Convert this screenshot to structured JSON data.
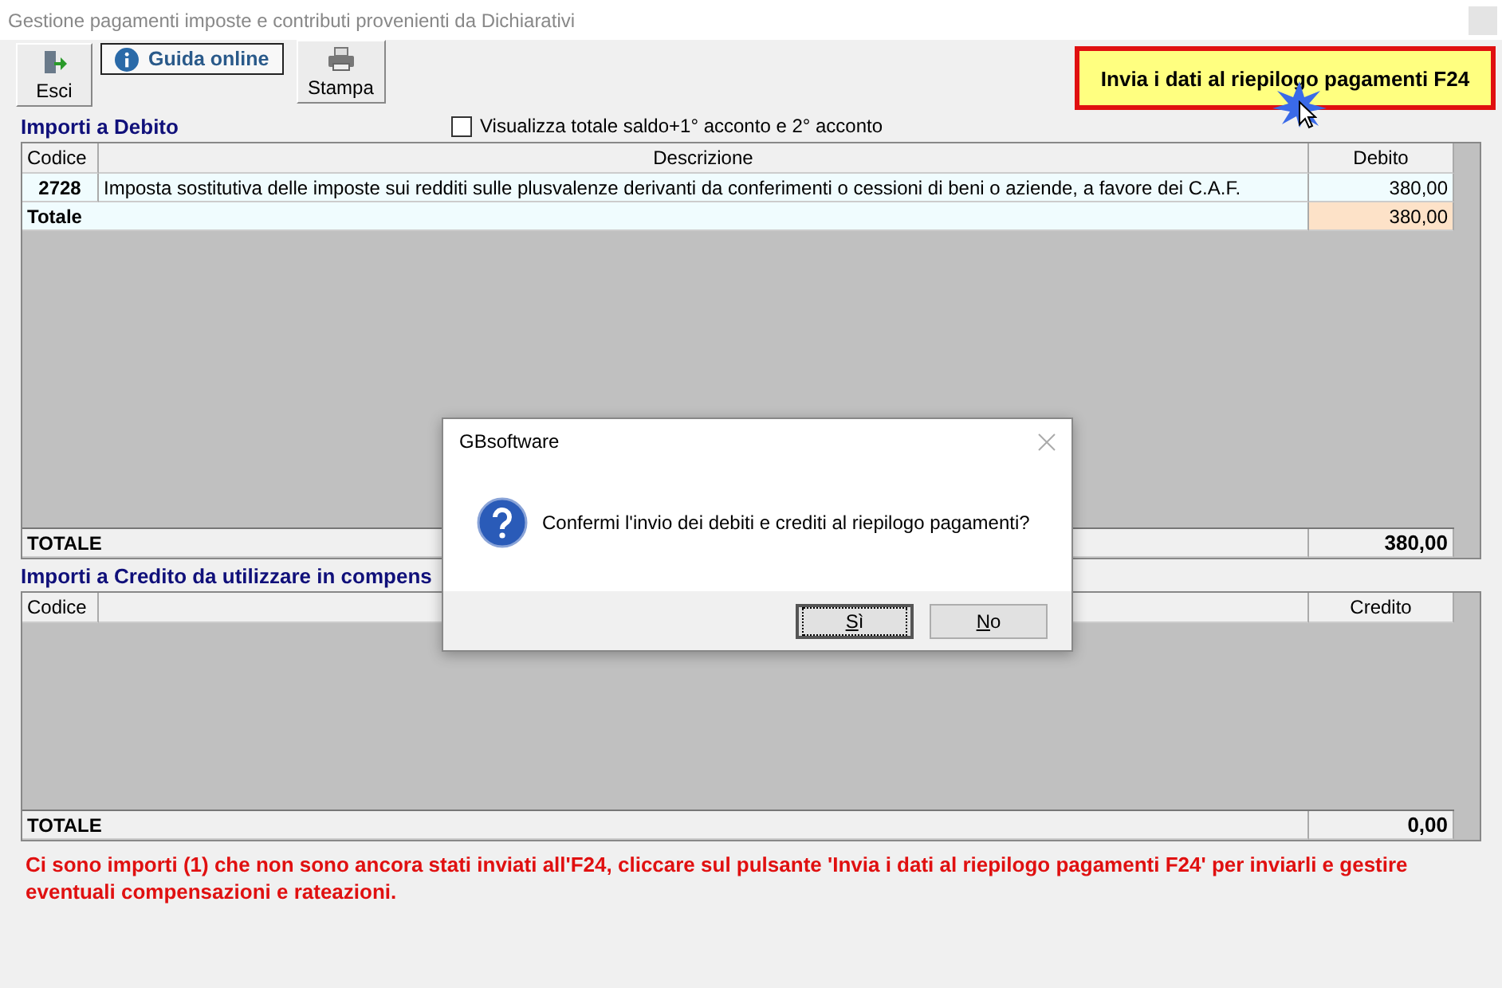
{
  "window": {
    "title": "Gestione pagamenti imposte e contributi provenienti da Dichiarativi"
  },
  "toolbar": [
    {
      "label": "Esci",
      "kind": "exit"
    },
    {
      "label": "Guida online",
      "kind": "help"
    },
    {
      "label": "Stampa",
      "kind": "print"
    }
  ],
  "send_button": {
    "label": "Invia i dati al riepilogo pagamenti F24"
  },
  "debit": {
    "title": "Importi a Debito",
    "checkbox": {
      "label": "Visualizza totale saldo+1° acconto e 2° acconto",
      "checked": false
    },
    "columns": [
      "Codice",
      "Descrizione",
      "Debito"
    ],
    "rows": [
      {
        "code": "2728",
        "description": "Imposta sostitutiva delle imposte sui redditi sulle plusvalenze derivanti da conferimenti o cessioni di beni o aziende, a favore dei C.A.F.",
        "amount": "380,00"
      }
    ],
    "subtotal": {
      "label": "Totale",
      "amount": "380,00"
    },
    "total": {
      "label": "TOTALE",
      "amount": "380,00"
    }
  },
  "credit": {
    "title": "Importi a Credito da utilizzare in compens",
    "columns": [
      "Codice",
      "Credito"
    ],
    "total": {
      "label": "TOTALE",
      "amount": "0,00"
    }
  },
  "message": "Ci sono importi (1) che non sono ancora stati inviati all'F24, cliccare sul pulsante 'Invia i dati al riepilogo pagamenti F24' per inviarli e gestire eventuali compensazioni e rateazioni.",
  "dialog": {
    "title": "GBsoftware",
    "message": "Confermi l'invio dei debiti e crediti al riepilogo pagamenti?",
    "buttons": [
      {
        "label": "Sì",
        "focused": true
      },
      {
        "label": "No",
        "focused": false
      }
    ]
  }
}
